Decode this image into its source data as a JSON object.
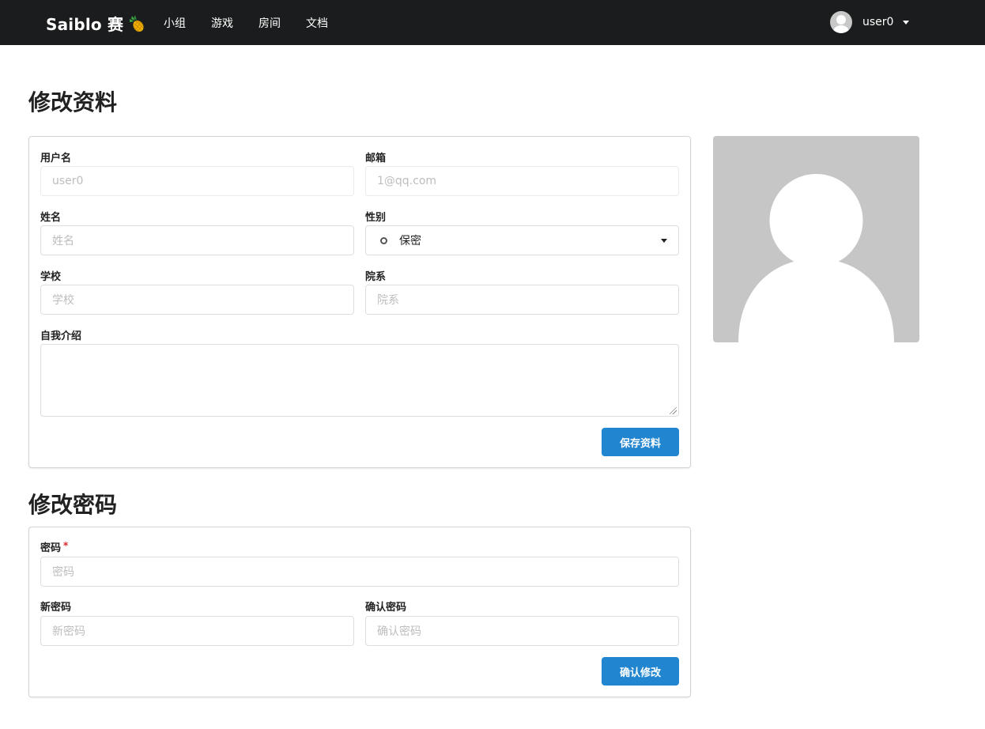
{
  "navbar": {
    "brand_text": "Saiblo 赛",
    "brand_icon": "pineapple-icon",
    "items": [
      {
        "label": "小组"
      },
      {
        "label": "游戏"
      },
      {
        "label": "房间"
      },
      {
        "label": "文档"
      }
    ],
    "user": {
      "name": "user0",
      "avatar_icon": "user-avatar-icon"
    }
  },
  "profile_section": {
    "title": "修改资料",
    "fields": {
      "username": {
        "label": "用户名",
        "placeholder": "user0"
      },
      "email": {
        "label": "邮箱",
        "placeholder": "1@qq.com"
      },
      "name": {
        "label": "姓名",
        "placeholder": "姓名"
      },
      "gender": {
        "label": "性别",
        "value": "保密"
      },
      "school": {
        "label": "学校",
        "placeholder": "学校"
      },
      "department": {
        "label": "院系",
        "placeholder": "院系"
      },
      "bio": {
        "label": "自我介绍",
        "value": ""
      }
    },
    "save_button": "保存资料"
  },
  "password_section": {
    "title": "修改密码",
    "fields": {
      "password": {
        "label": "密码",
        "required_mark": "*",
        "placeholder": "密码"
      },
      "new_password": {
        "label": "新密码",
        "placeholder": "新密码"
      },
      "confirm_password": {
        "label": "确认密码",
        "placeholder": "确认密码"
      }
    },
    "confirm_button": "确认修改"
  },
  "colors": {
    "navbar_bg": "#1b1c1d",
    "primary": "#2185d0",
    "avatar_bg": "#c6c6c6",
    "required": "#db2828"
  }
}
